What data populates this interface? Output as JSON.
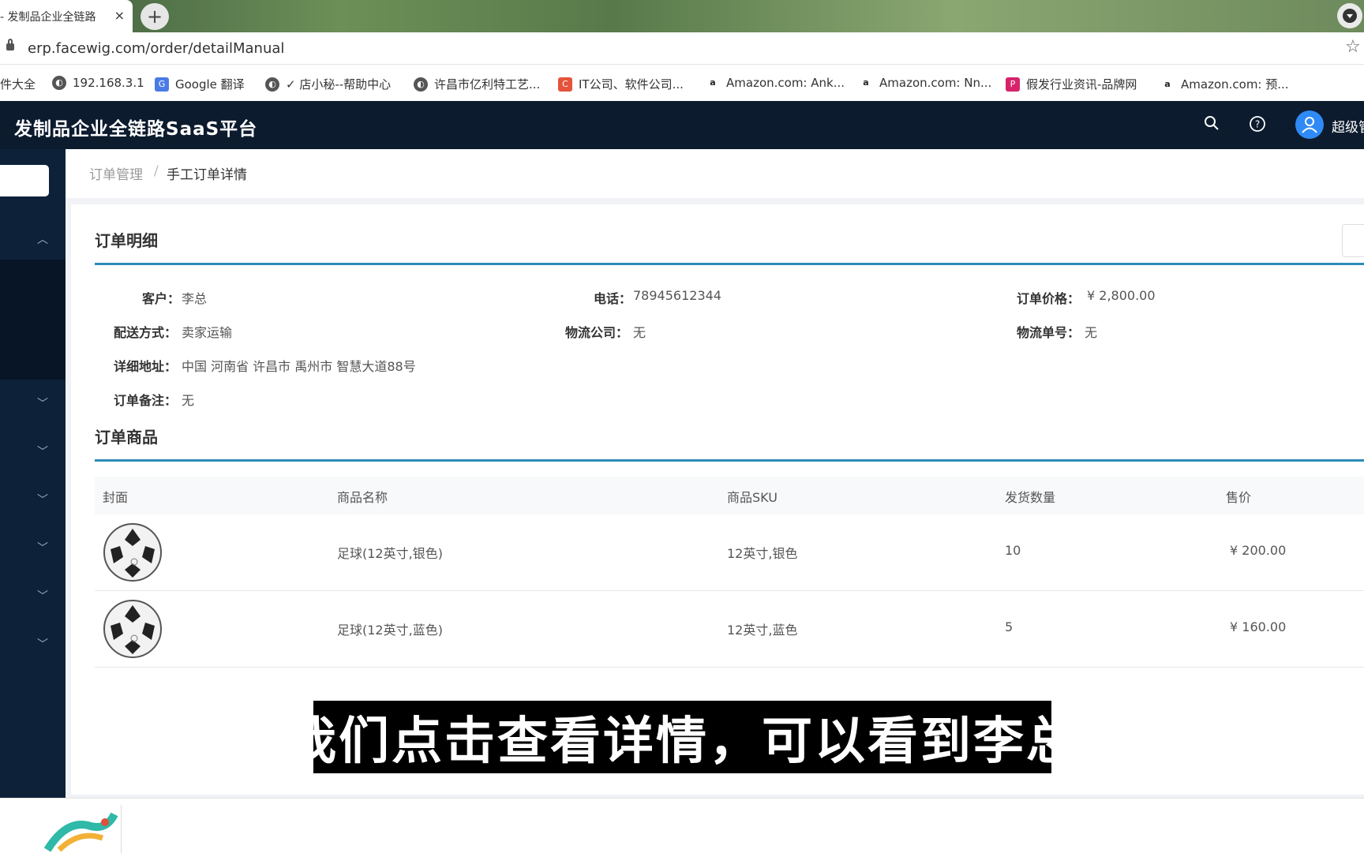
{
  "browser": {
    "tab_title": "- 发制品企业全链路",
    "tab_close": "×",
    "new_tab": "+",
    "url": "erp.facewig.com/order/detailManual",
    "bookmarks": [
      {
        "label": "件大全",
        "icon": "none"
      },
      {
        "label": "192.168.3.1",
        "icon": "globe-icon"
      },
      {
        "label": "Google 翻译",
        "icon": "translate-icon"
      },
      {
        "label": "✓ 店小秘--帮助中心",
        "icon": "globe-icon"
      },
      {
        "label": "许昌市亿利特工艺...",
        "icon": "globe-icon"
      },
      {
        "label": "IT公司、软件公司...",
        "icon": "c-logo-icon"
      },
      {
        "label": "Amazon.com: Ank...",
        "icon": "amazon-icon"
      },
      {
        "label": "Amazon.com: Nn...",
        "icon": "amazon-icon"
      },
      {
        "label": "假发行业资讯-品牌网",
        "icon": "p-logo-icon"
      },
      {
        "label": "Amazon.com: 预...",
        "icon": "amazon-icon"
      }
    ]
  },
  "header": {
    "title": "发制品企业全链路SaaS平台",
    "username": "超级管"
  },
  "breadcrumb": {
    "parent": "订单管理",
    "separator": "/",
    "current": "手工订单详情"
  },
  "order_detail": {
    "section_title": "订单明细",
    "customer_label": "客户：",
    "customer_value": "李总",
    "phone_label": "电话：",
    "phone_value": "78945612344",
    "price_label": "订单价格：",
    "price_value": "¥ 2,800.00",
    "shipping_label": "配送方式：",
    "shipping_value": "卖家运输",
    "logistics_label": "物流公司：",
    "logistics_value": "无",
    "tracking_label": "物流单号：",
    "tracking_value": "无",
    "address_label": "详细地址：",
    "address_value": "中国 河南省 许昌市 禹州市 智慧大道88号",
    "remark_label": "订单备注：",
    "remark_value": "无"
  },
  "order_goods": {
    "section_title": "订单商品",
    "columns": [
      "封面",
      "商品名称",
      "商品SKU",
      "发货数量",
      "售价"
    ],
    "rows": [
      {
        "name": "足球(12英寸,银色)",
        "sku": "12英寸,银色",
        "qty": "10",
        "price": "¥ 200.00"
      },
      {
        "name": "足球(12英寸,蓝色)",
        "sku": "12英寸,蓝色",
        "qty": "5",
        "price": "¥ 160.00"
      }
    ]
  },
  "subtitle": "我们点击查看详情，可以看到李总"
}
